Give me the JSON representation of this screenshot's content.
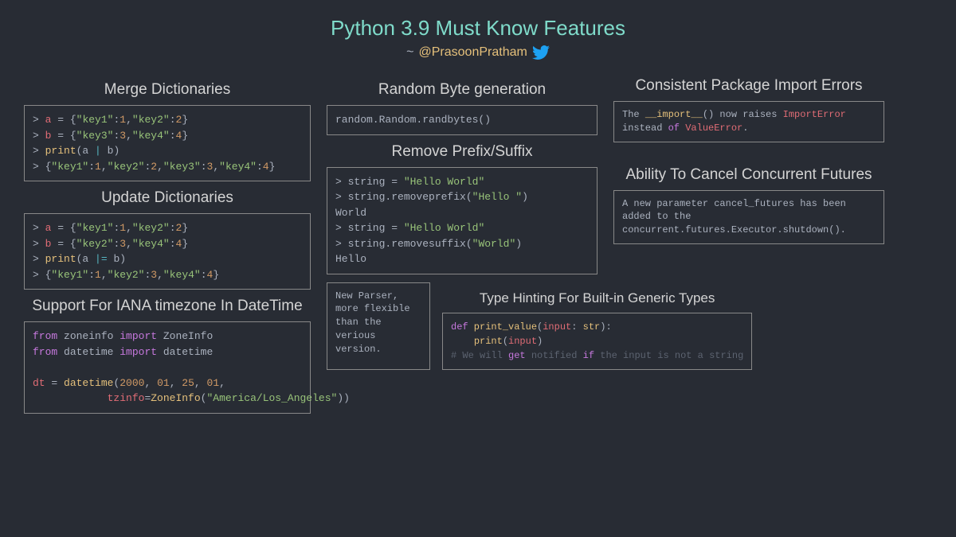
{
  "header": {
    "title": "Python 3.9 Must Know Features",
    "tilde": "~",
    "author": "@PrasoonPratham"
  },
  "col1": {
    "merge": {
      "title": "Merge Dictionaries",
      "line1_prompt": "> ",
      "line1_a": "a ",
      "line1_eq": "= ",
      "line1_brace": "{",
      "line1_k1": "\"key1\"",
      "line1_c1": ":",
      "line1_v1": "1",
      "line1_cm1": ",",
      "line1_k2": "\"key2\"",
      "line1_c2": ":",
      "line1_v2": "2",
      "line1_brace2": "}",
      "line2_prompt": "> ",
      "line2_a": "b ",
      "line2_eq": "= ",
      "line2_brace": "{",
      "line2_k1": "\"key3\"",
      "line2_c1": ":",
      "line2_v1": "3",
      "line2_cm1": ",",
      "line2_k2": "\"key4\"",
      "line2_c2": ":",
      "line2_v2": "4",
      "line2_brace2": "}",
      "line3_prompt": "> ",
      "line3_print": "print",
      "line3_paren": "(a ",
      "line3_pipe": "|",
      "line3_end": " b)",
      "line4_prompt": "> ",
      "line4_brace": "{",
      "line4_k1": "\"key1\"",
      "line4_c1": ":",
      "line4_v1": "1",
      "line4_cm1": ",",
      "line4_k2": "\"key2\"",
      "line4_c2": ":",
      "line4_v2": "2",
      "line4_cm2": ",",
      "line4_k3": "\"key3\"",
      "line4_c3": ":",
      "line4_v3": "3",
      "line4_cm3": ",",
      "line4_k4": "\"key4\"",
      "line4_c4": ":",
      "line4_v4": "4",
      "line4_brace2": "}"
    },
    "update": {
      "title": "Update Dictionaries",
      "line1_prompt": "> ",
      "line1_a": "a ",
      "line1_eq": "= ",
      "line1_brace": "{",
      "line1_k1": "\"key1\"",
      "line1_c1": ":",
      "line1_v1": "1",
      "line1_cm1": ",",
      "line1_k2": "\"key2\"",
      "line1_c2": ":",
      "line1_v2": "2",
      "line1_brace2": "}",
      "line2_prompt": "> ",
      "line2_a": "b ",
      "line2_eq": "= ",
      "line2_brace": "{",
      "line2_k1": "\"key2\"",
      "line2_c1": ":",
      "line2_v1": "3",
      "line2_cm1": ",",
      "line2_k2": "\"key4\"",
      "line2_c2": ":",
      "line2_v2": "4",
      "line2_brace2": "}",
      "line3_prompt": "> ",
      "line3_print": "print",
      "line3_paren": "(a ",
      "line3_pipe": "|=",
      "line3_end": " b)",
      "line4_prompt": "> ",
      "line4_brace": "{",
      "line4_k1": "\"key1\"",
      "line4_c1": ":",
      "line4_v1": "1",
      "line4_cm1": ",",
      "line4_k2": "\"key2\"",
      "line4_c2": ":",
      "line4_v2": "3",
      "line4_cm2": ",",
      "line4_k3": "\"key4\"",
      "line4_c3": ":",
      "line4_v3": "4",
      "line4_brace2": "}"
    },
    "iana": {
      "title": "Support For IANA timezone In DateTime",
      "from1": "from",
      "mod1": " zoneinfo ",
      "imp1": "import",
      "cls1": " ZoneInfo",
      "from2": "from",
      "mod2": " datetime ",
      "imp2": "import",
      "cls2": " datetime",
      "dt": "dt ",
      "eq": "= ",
      "dtfn": "datetime",
      "p": "(",
      "n1": "2000",
      "c1": ", ",
      "n2": "01",
      "c2": ", ",
      "n3": "25",
      "c3": ", ",
      "n4": "01",
      "c4": ",",
      "indent": "            ",
      "tzinfo": "tzinfo",
      "eq2": "=",
      "zfn": "ZoneInfo",
      "p2": "(",
      "tz": "\"America/Los_Angeles\"",
      "p3": "))"
    }
  },
  "col2": {
    "random": {
      "title": "Random Byte generation",
      "code": "random.Random.randbytes()"
    },
    "prefix": {
      "title": "Remove Prefix/Suffix",
      "l1a": "> string ",
      "l1b": "= ",
      "l1c": "\"Hello World\"",
      "l2a": "> string.removeprefix(",
      "l2b": "\"Hello \"",
      "l2c": ")",
      "l3": "World",
      "l4a": "> string ",
      "l4b": "= ",
      "l4c": "\"Hello World\"",
      "l5a": "> string.removesuffix(",
      "l5b": "\"World\"",
      "l5c": ")",
      "l6": "Hello"
    },
    "parser": {
      "text": "New Parser, more flexible than the verious version."
    }
  },
  "col3": {
    "import": {
      "title": "Consistent Package Import Errors",
      "t1": "The ",
      "t2": "__import__",
      "t3": "() now raises ",
      "t4": "ImportError",
      "t5": " instead ",
      "t6": "of",
      "t7": " ",
      "t8": "ValueError",
      "t9": "."
    },
    "cancel": {
      "title": "Ability To Cancel Concurrent Futures",
      "text": "A new parameter cancel_futures has been added to the concurrent.futures.Executor.shutdown()."
    },
    "typehint": {
      "title": "Type Hinting For Built-in Generic Types",
      "def": "def",
      "fn": " print_value",
      "paren": "(",
      "inp": "input",
      "colon": ": ",
      "strt": "str",
      "paren2": "):",
      "indent": "    ",
      "print": "print",
      "paren3": "(",
      "inp2": "input",
      "paren4": ")",
      "ct1": "# We will ",
      "ct2": "get",
      "ct3": " notified ",
      "ct4": "if",
      "ct5": " the input is not a string"
    }
  }
}
